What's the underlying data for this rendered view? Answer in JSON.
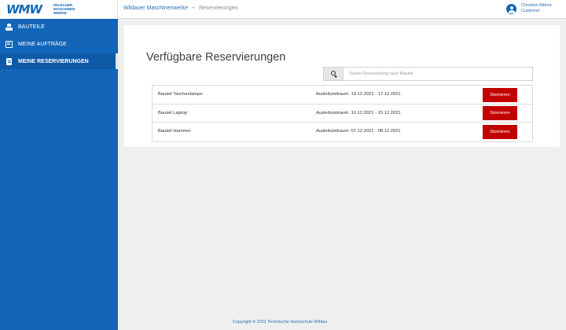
{
  "brand": {
    "logo_mark": "WMW",
    "logo_text": [
      "WILDAUER",
      "MASCHINEN",
      "WERKE"
    ]
  },
  "breadcrumb": {
    "root": "Wildauer Maschinenwerke",
    "separator": "•",
    "current": "Reservierungen"
  },
  "user": {
    "name": "Christian Bittner",
    "role": "Customer",
    "icon": "user-circle-icon"
  },
  "sidebar": {
    "items": [
      {
        "label": "BAUTEILE",
        "icon": "component-icon",
        "active": false
      },
      {
        "label": "MEINE AUFTRÄGE",
        "icon": "orders-icon",
        "active": false
      },
      {
        "label": "MEINE RESERVIERUNGEN",
        "icon": "document-icon",
        "active": true
      }
    ]
  },
  "main": {
    "title": "Verfügbare Reservierungen",
    "search": {
      "placeholder": "Suche Reservierung nach Bauteil",
      "value": "",
      "icon": "search-icon"
    },
    "reservations": [
      {
        "part": "Bauteil Taschenlampe",
        "period": "Ausleihzeitraum: 13.12.2021 - 17.12.2021",
        "action": "Stornieren"
      },
      {
        "part": "Bauteil Laptop",
        "period": "Ausleihzeitraum: 10.12.2021 - 15.12.2021",
        "action": "Stornieren"
      },
      {
        "part": "Bauteil Hammer",
        "period": "Ausleihzeitraum: 07.12.2021 - 08.12.2021",
        "action": "Stornieren"
      }
    ]
  },
  "footer": {
    "text": "Copyright © 2021 Technische Hochschule Wildau"
  },
  "colors": {
    "brand_blue": "#1265b8",
    "cancel_red": "#c20000",
    "background": "#efefef"
  }
}
